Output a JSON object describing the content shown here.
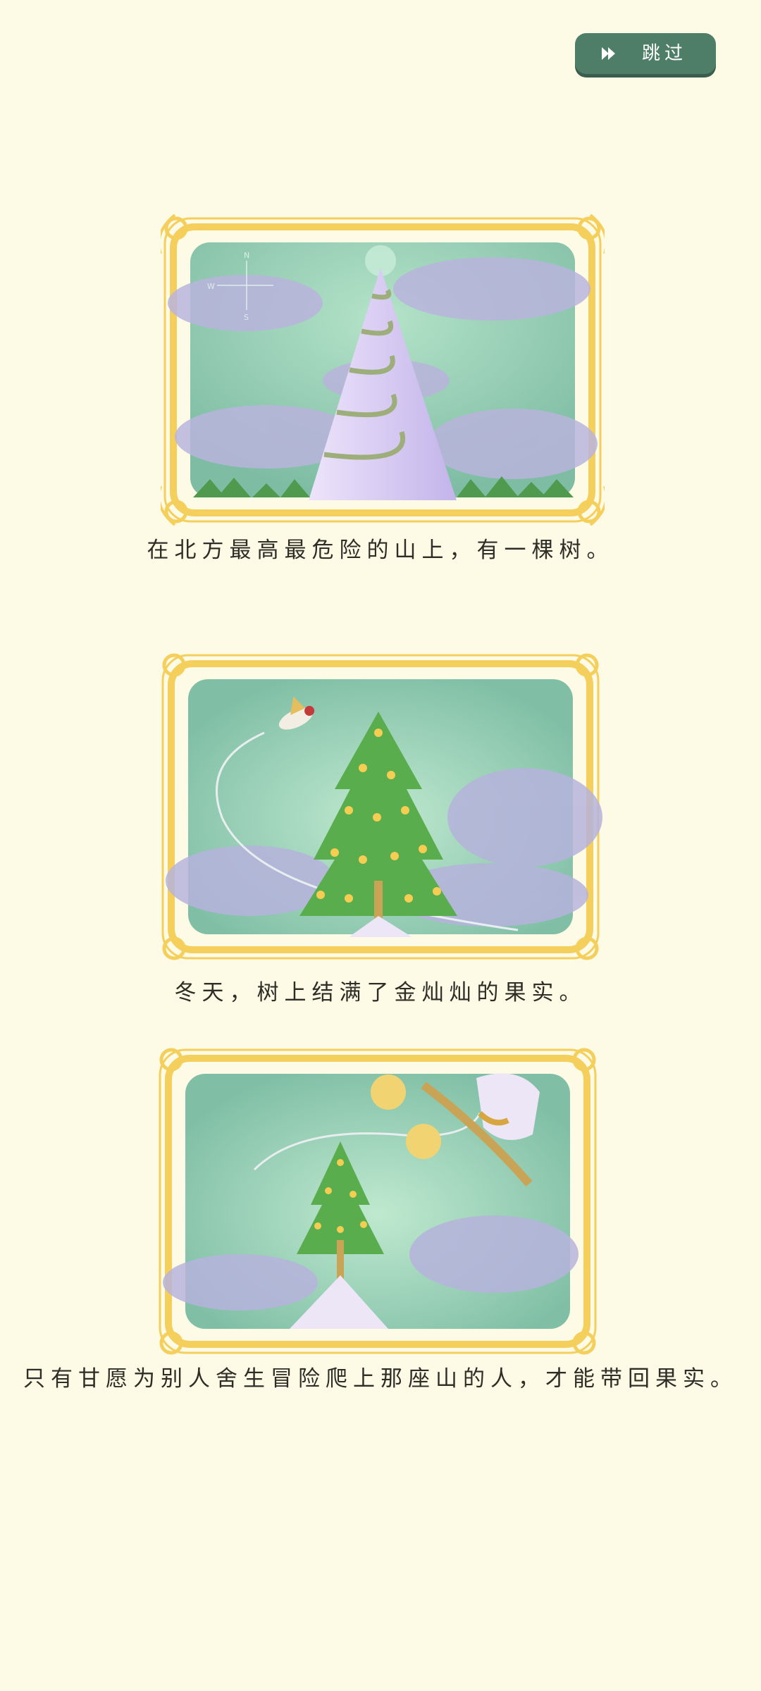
{
  "skip_button": {
    "label": "跳过",
    "icon": "fast-forward-icon"
  },
  "panels": [
    {
      "caption": "在北方最高最危险的山上，有一棵树。",
      "compass": {
        "n": "N",
        "w": "W",
        "s": "S"
      }
    },
    {
      "caption": "冬天，树上结满了金灿灿的果实。"
    },
    {
      "caption": "只有甘愿为别人舍生冒险爬上那座山的人，才能带回果实。"
    }
  ],
  "colors": {
    "background": "#fdfae6",
    "frame_gold": "#f5cf5c",
    "sky": "#8cc6ae",
    "button": "#4f7e68"
  }
}
